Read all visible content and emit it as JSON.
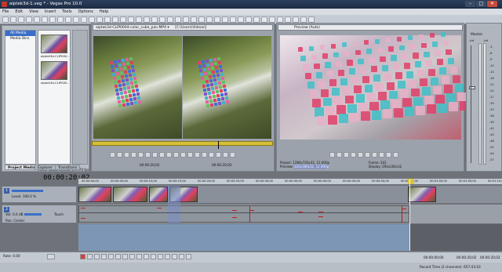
{
  "window": {
    "title": "aiptek3d-1.veg * - Vegas Pro 10.0",
    "min": "–",
    "max": "□",
    "close": "✕"
  },
  "menu": [
    "File",
    "Edit",
    "View",
    "Insert",
    "Tools",
    "Options",
    "Help"
  ],
  "explorer": {
    "tree": [
      "All Media",
      "Media Bins"
    ],
    "items": [
      "aiptek3d-CLIP000…",
      "aiptek3d-CLIP000…"
    ],
    "info": [
      "Video: 1280x720x32, 29.970 fps",
      "Audio: 48,000 Hz, Stereo, 00:00:0…"
    ],
    "tabs": [
      "Project Media",
      "Explorer",
      "Transitions"
    ]
  },
  "trimmer": {
    "file": "aiptek3d-CLIP0004-color_cube_pan.MP4 ▾",
    "path": "[C:\\Users\\Videos\\]",
    "tc1": "00:00:20;02",
    "tc2": "00:00:20;02"
  },
  "preview": {
    "label": "Preview (Auto)",
    "project_label": "Project:",
    "project": "1280x720x32, 12.000p",
    "preview_label": "Preview:",
    "preview_val": "320x180x32, 12.000p",
    "frame_label": "Frame:",
    "frame": "241",
    "display_label": "Display:",
    "display": "293x164x32"
  },
  "master": {
    "label": "Master",
    "db1": "-Inf",
    "db2": "-Inf",
    "scale": [
      "-3",
      "-6",
      "-9",
      "-12",
      "-15",
      "-18",
      "-21",
      "-24",
      "-27",
      "-30",
      "-33",
      "-36",
      "-39",
      "-42",
      "-45",
      "-48",
      "-51",
      "-54",
      "-57"
    ]
  },
  "timeline": {
    "timecode": "00:00:20;02",
    "ruler": [
      "00:00:00;00",
      "00:00:05;00",
      "00:00:10;00",
      "00:00:15;00",
      "00:00:20;00",
      "00:00:25;00",
      "00:00:30;00",
      "00:00:35;00",
      "00:00:40;00",
      "00:00:45;00",
      "00:00:50;00",
      "00:00:55;00",
      "00:01:00;00",
      "00:01:05;00",
      "00:01:10;00"
    ],
    "video_track": {
      "num": "1",
      "level_label": "Level:",
      "level": "100.0 %"
    },
    "audio_track": {
      "num": "2",
      "vol_label": "Vol:",
      "vol": "0.0 dB",
      "pan_label": "Pan:",
      "pan": "Center",
      "touch": "Touch"
    },
    "marker": "00:00:20;02"
  },
  "transport": {
    "rate_label": "Rate:",
    "rate": "0.00",
    "tc1": "00:00:00;00",
    "tc2": "00:00:20;02",
    "tc3": "00:00:20;02"
  },
  "status": {
    "record": "Record Time (2 channels): 657:43:10"
  }
}
